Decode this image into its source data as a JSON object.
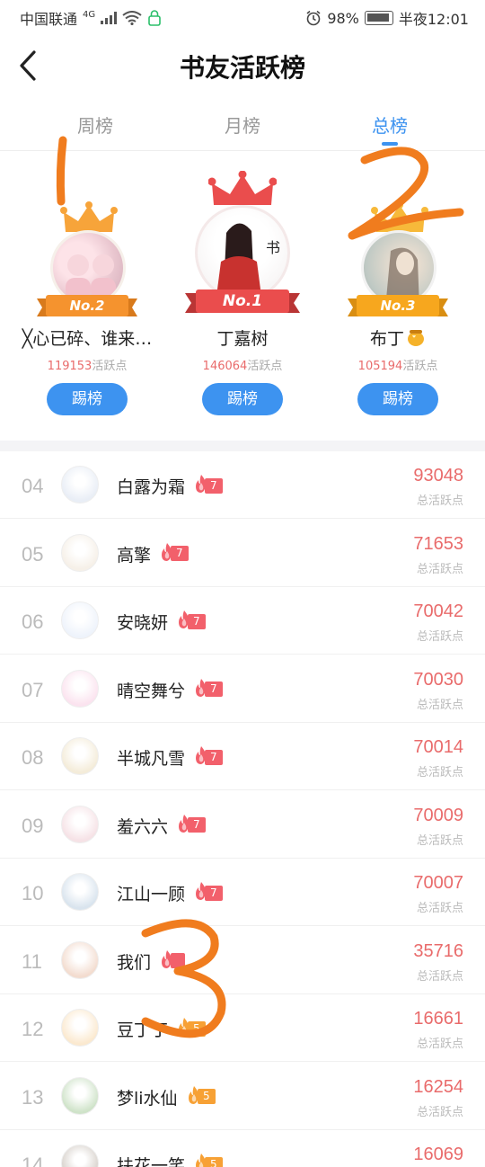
{
  "status_bar": {
    "carrier": "中国联通",
    "network": "4G",
    "battery": "98%",
    "time": "半夜12:01"
  },
  "header": {
    "title": "书友活跃榜"
  },
  "tabs": [
    {
      "label": "周榜",
      "active": false
    },
    {
      "label": "月榜",
      "active": false
    },
    {
      "label": "总榜",
      "active": true
    }
  ],
  "podium": {
    "kick_label": "踢榜",
    "points_suffix": "活跃点",
    "entries": [
      {
        "place": "No.2",
        "name": "╳心已碎、谁来…",
        "points": "119153",
        "ribbon_color": "#f5932e"
      },
      {
        "place": "No.1",
        "name": "丁嘉树",
        "points": "146064",
        "ribbon_color": "#ea4d4d"
      },
      {
        "place": "No.3",
        "name": "布丁",
        "points": "105194",
        "ribbon_color": "#f7a71e"
      }
    ]
  },
  "list": {
    "score_caption": "总活跃点",
    "rows": [
      {
        "rank": "04",
        "name": "白露为霜",
        "level": "7",
        "score": "93048"
      },
      {
        "rank": "05",
        "name": "高擎",
        "level": "7",
        "score": "71653"
      },
      {
        "rank": "06",
        "name": "安晓妍",
        "level": "7",
        "score": "70042"
      },
      {
        "rank": "07",
        "name": "晴空舞兮",
        "level": "7",
        "score": "70030"
      },
      {
        "rank": "08",
        "name": "半城凡雪",
        "level": "7",
        "score": "70014"
      },
      {
        "rank": "09",
        "name": "羞六六",
        "level": "7",
        "score": "70009"
      },
      {
        "rank": "10",
        "name": "江山一顾",
        "level": "7",
        "score": "70007"
      },
      {
        "rank": "11",
        "name": "我们",
        "level": "",
        "score": "35716"
      },
      {
        "rank": "12",
        "name": "豆丁丁",
        "level": "5",
        "score": "16661"
      },
      {
        "rank": "13",
        "name": "梦li水仙",
        "level": "5",
        "score": "16254"
      },
      {
        "rank": "14",
        "name": "扶花一笑",
        "level": "5",
        "score": "16069"
      }
    ]
  },
  "annotations": [
    {
      "text": "1",
      "color": "#f07c1e"
    },
    {
      "text": "2",
      "color": "#f07c1e"
    },
    {
      "text": "3",
      "color": "#f07c1e"
    }
  ]
}
